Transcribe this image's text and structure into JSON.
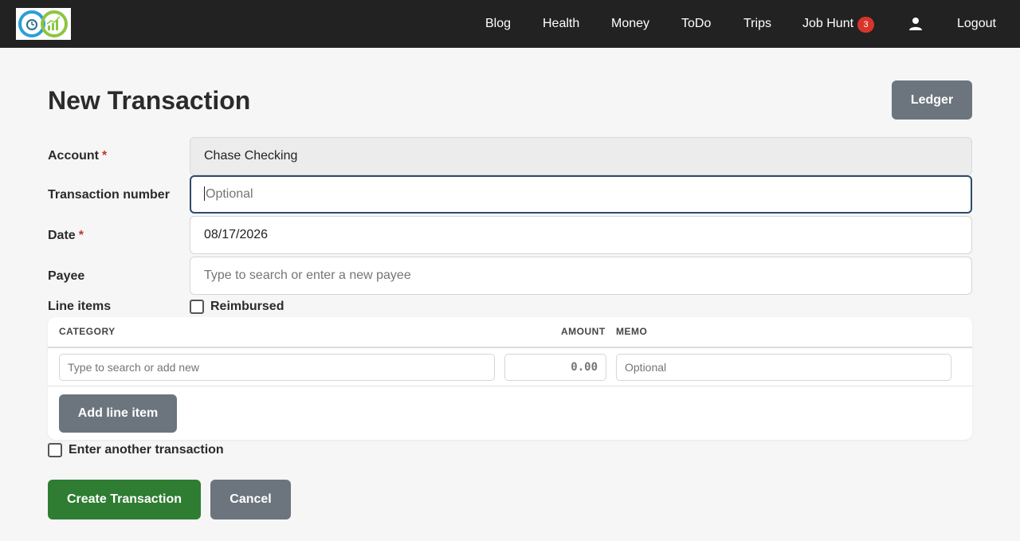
{
  "navbar": {
    "logo": "app-logo",
    "items": [
      {
        "label": "Blog"
      },
      {
        "label": "Health"
      },
      {
        "label": "Money"
      },
      {
        "label": "ToDo"
      },
      {
        "label": "Trips"
      },
      {
        "label": "Job Hunt"
      }
    ],
    "job_hunt_badge": "3",
    "user_icon": "user-icon",
    "logout_label": "Logout"
  },
  "page": {
    "title": "New Transaction",
    "ledger_label": "Ledger"
  },
  "form": {
    "account": {
      "label": "Account",
      "required_mark": "*",
      "value": "Chase Checking"
    },
    "transaction_number": {
      "label": "Transaction number",
      "placeholder": "Optional",
      "value": ""
    },
    "date": {
      "label": "Date",
      "required_mark": "*",
      "value": "08/17/2026"
    },
    "payee": {
      "label": "Payee",
      "placeholder": "Type to search or enter a new payee"
    },
    "line_items_label": "Line items",
    "reimbursed": {
      "label": "Reimbursed",
      "checked": false
    }
  },
  "line_items": {
    "headers": {
      "category": "CATEGORY",
      "amount": "AMOUNT",
      "memo": "MEMO"
    },
    "rows": [
      {
        "category_placeholder": "Type to search or add new",
        "amount": "0.00",
        "memo_placeholder": "Optional"
      }
    ],
    "add_label": "Add line item"
  },
  "enter_another": {
    "label": "Enter another transaction",
    "checked": false
  },
  "actions": {
    "create_label": "Create Transaction",
    "cancel_label": "Cancel"
  },
  "colors": {
    "navbar_bg": "#222222",
    "primary_green": "#2e7d32",
    "secondary_gray": "#6c757d",
    "badge_red": "#d9342b",
    "required_red": "#c0392b"
  }
}
